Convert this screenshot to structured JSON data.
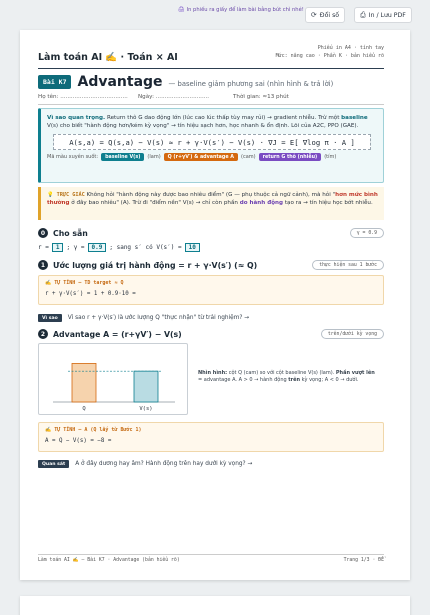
{
  "topbar": {
    "tip_icon": "printer-icon",
    "tip_text": "In phiếu ra giấy để làm bài bằng bút chì nhé!",
    "reset_label": "Đổi số",
    "print_label": "In / Lưu PDF"
  },
  "header": {
    "left_title": "Làm toán AI ✍️ · Toán × AI",
    "right_line1": "Phiếu in A4 · tính tay",
    "right_line2": "Mức: nâng cao · Phần K · bản hiểu rõ"
  },
  "lesson": {
    "tag": "Bài K7",
    "title": "Advantage",
    "subtitle": "— baseline giảm phương sai (nhìn hình & trả lời)"
  },
  "meta": {
    "name_label": "Họ tên: ......................................",
    "date_label": "Ngày: ..............................",
    "time_label": "Thời gian: ≈13 phút"
  },
  "why_box": {
    "lead": "Vì sao quan trọng.",
    "text_a": " Return thô G dao động lớn (lúc cao lúc thấp tùy may rủi) → gradient nhiễu. Trừ một ",
    "baseline_word": "baseline",
    "text_b": " V(s) cho biết \"hành động hơn/kém kỳ vọng\" → tín hiệu sạch hơn, học nhanh & ổn định. Lõi của A2C, PPO (GAE).",
    "formula": "A(s,a) = Q(s,a) − V(s) ≈ r + γ·V(s′) − V(s) · ∇J = E[ ∇log π · A ]",
    "legend_lead": "Mã màu xuyên suốt:",
    "legend_items": [
      {
        "label": "baseline V(s)",
        "note": "(lam)"
      },
      {
        "label": "Q (r+γV′) & advantage A",
        "note": "(cam)"
      },
      {
        "label": "return G thô (nhiễu)",
        "note": "(tím)"
      }
    ]
  },
  "hint_box": {
    "lead": "💡 TRỰC GIÁC",
    "text_a": " Không hỏi \"hành động này được bao nhiêu điểm\" (G — phụ thuộc cả ngữ cảnh), mà hỏi \"",
    "highlight": "hơn mức bình thường",
    "text_b": " ở đây bao nhiêu\" (A). Trừ đi \"điểm nền\" V(s) → chỉ còn phần ",
    "purple_part": "do hành động",
    "text_c": " tạo ra → tín hiệu học bớt nhiễu."
  },
  "section0": {
    "num": "0",
    "title": "Cho sẵn",
    "pill": "γ = 0.9",
    "r_label": "r =",
    "r_value": "1",
    "gamma_label": "; γ =",
    "gamma_value": "0.9",
    "next_label": "; sang s′ có V(s′) =",
    "next_value": "10"
  },
  "section1": {
    "num": "1",
    "title": "Ước lượng giá trị hành động = r + γ·V(s′) (≈ Q)",
    "pill": "thực hiện sau 1 bước",
    "work_title": "✍️ TỰ TÍNH — TD target ≈ Q",
    "work_line": "r + γ·V(s′) = 1 + 0.9·10 =",
    "ask_tag": "Vì sao",
    "ask_text": "Vì sao r + γ·V(s′) là ước lượng Q \"thực nhận\" từ trải nghiệm? →"
  },
  "section2": {
    "num": "2",
    "title": "Advantage A = (r+γV′) − V(s)",
    "pill": "trên/dưới kỳ vọng",
    "note_lead": "Nhìn hình:",
    "note_a": " cột Q (cam) so với cột baseline V(s) (lam). ",
    "note_b": "Phần vượt lên",
    "note_c": " = advantage A. A > 0 → hành động ",
    "note_d": "trên",
    "note_e": " kỳ vọng; A < 0 → dưới.",
    "work_title": "✍️ TỰ TÍNH — A (Q lấy từ Bước 1)",
    "work_line": "A = Q − V(s) = −8 =",
    "ask_tag": "Quan sát",
    "ask_text": "A ở đây dương hay âm? Hành động trên hay dưới kỳ vọng? →"
  },
  "chart_data": {
    "type": "bar",
    "categories": [
      "Q",
      "V(s)"
    ],
    "values": [
      10,
      8
    ],
    "colors": [
      "#f6d3ad",
      "#b9dce3"
    ],
    "stroke_colors": [
      "#d4690f",
      "#0e7f8f"
    ],
    "ylim": [
      0,
      14
    ],
    "grid": false
  },
  "footer": {
    "left": "Làm toán AI ✍️ — Bài K7 · Advantage (bản hiểu rõ)",
    "right": "Trang 1/3 · ĐỀ"
  }
}
